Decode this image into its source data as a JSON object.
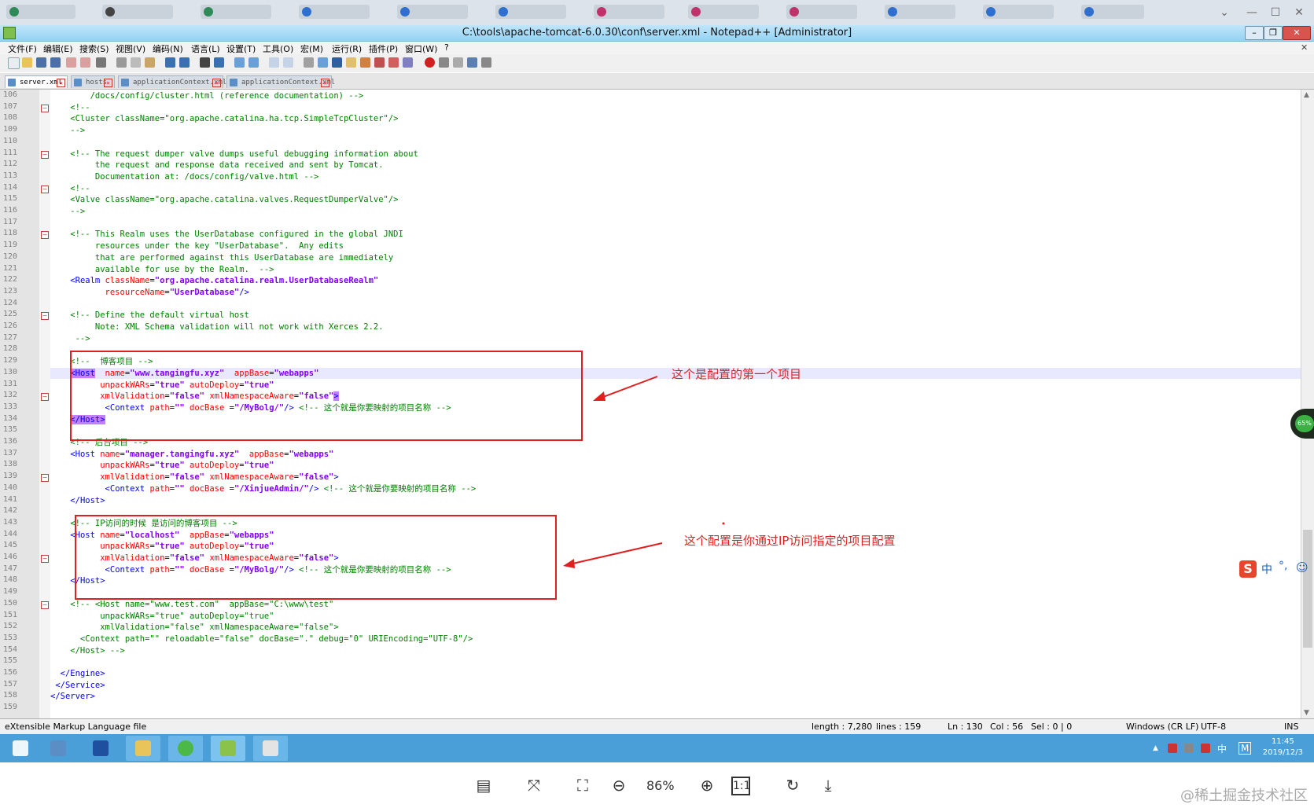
{
  "window": {
    "title": "C:\\tools\\apache-tomcat-6.0.30\\conf\\server.xml - Notepad++ [Administrator]"
  },
  "menu": [
    "文件(F)",
    "编辑(E)",
    "搜索(S)",
    "视图(V)",
    "编码(N)",
    "语言(L)",
    "设置(T)",
    "工具(O)",
    "宏(M)",
    "运行(R)",
    "插件(P)",
    "窗口(W)",
    "?"
  ],
  "tabs": [
    "server.xml",
    "hosts",
    "applicationContext.xml",
    "applicationContext.xml"
  ],
  "code_lines": [
    {
      "n": "106",
      "segs": [
        {
          "t": "        /docs/config/cluster.html (reference documentation) -->",
          "c": "cm"
        }
      ]
    },
    {
      "n": "107",
      "segs": [
        {
          "t": "    <!--",
          "c": "cm"
        }
      ]
    },
    {
      "n": "108",
      "segs": [
        {
          "t": "    <Cluster className=\"org.apache.catalina.ha.tcp.SimpleTcpCluster\"/>",
          "c": "cm"
        }
      ]
    },
    {
      "n": "109",
      "segs": [
        {
          "t": "    -->",
          "c": "cm"
        }
      ]
    },
    {
      "n": "110",
      "segs": []
    },
    {
      "n": "111",
      "segs": [
        {
          "t": "    <!-- The request dumper valve dumps useful debugging information about",
          "c": "cm"
        }
      ]
    },
    {
      "n": "112",
      "segs": [
        {
          "t": "         the request and response data received and sent by Tomcat.",
          "c": "cm"
        }
      ]
    },
    {
      "n": "113",
      "segs": [
        {
          "t": "         Documentation at: /docs/config/valve.html -->",
          "c": "cm"
        }
      ]
    },
    {
      "n": "114",
      "segs": [
        {
          "t": "    <!--",
          "c": "cm"
        }
      ]
    },
    {
      "n": "115",
      "segs": [
        {
          "t": "    <Valve className=\"org.apache.catalina.valves.RequestDumperValve\"/>",
          "c": "cm"
        }
      ]
    },
    {
      "n": "116",
      "segs": [
        {
          "t": "    -->",
          "c": "cm"
        }
      ]
    },
    {
      "n": "117",
      "segs": []
    },
    {
      "n": "118",
      "segs": [
        {
          "t": "    <!-- This Realm uses the UserDatabase configured in the global JNDI",
          "c": "cm"
        }
      ]
    },
    {
      "n": "119",
      "segs": [
        {
          "t": "         resources under the key \"UserDatabase\".  Any edits",
          "c": "cm"
        }
      ]
    },
    {
      "n": "120",
      "segs": [
        {
          "t": "         that are performed against this UserDatabase are immediately",
          "c": "cm"
        }
      ]
    },
    {
      "n": "121",
      "segs": [
        {
          "t": "         available for use by the Realm.  -->",
          "c": "cm"
        }
      ]
    },
    {
      "n": "122",
      "segs": [
        {
          "t": "    ",
          "c": "txt"
        },
        {
          "t": "<Realm",
          "c": "tag"
        },
        {
          "t": " className",
          "c": "attr"
        },
        {
          "t": "=",
          "c": "txt"
        },
        {
          "t": "\"org.apache.catalina.realm.UserDatabaseRealm\"",
          "c": "val"
        }
      ]
    },
    {
      "n": "123",
      "segs": [
        {
          "t": "           resourceName",
          "c": "attr"
        },
        {
          "t": "=",
          "c": "txt"
        },
        {
          "t": "\"UserDatabase\"",
          "c": "val"
        },
        {
          "t": "/>",
          "c": "tag"
        }
      ]
    },
    {
      "n": "124",
      "segs": []
    },
    {
      "n": "125",
      "segs": [
        {
          "t": "    <!-- Define the default virtual host",
          "c": "cm"
        }
      ]
    },
    {
      "n": "126",
      "segs": [
        {
          "t": "         Note: XML Schema validation will not work with Xerces 2.2.",
          "c": "cm"
        }
      ]
    },
    {
      "n": "127",
      "segs": [
        {
          "t": "     -->",
          "c": "cm"
        }
      ]
    },
    {
      "n": "128",
      "segs": []
    },
    {
      "n": "129",
      "segs": [
        {
          "t": "    <!--  博客项目 -->",
          "c": "cm"
        }
      ]
    },
    {
      "n": "130",
      "segs": [
        {
          "t": "    ",
          "c": "txt"
        },
        {
          "t": "<Host",
          "c": "tag",
          "hl": true
        },
        {
          "t": "  name",
          "c": "attr"
        },
        {
          "t": "=",
          "c": "txt"
        },
        {
          "t": "\"www.tangingfu.xyz\"",
          "c": "val"
        },
        {
          "t": "  appBase",
          "c": "attr"
        },
        {
          "t": "=",
          "c": "txt"
        },
        {
          "t": "\"webapps\"",
          "c": "val"
        }
      ]
    },
    {
      "n": "131",
      "segs": [
        {
          "t": "          unpackWARs",
          "c": "attr"
        },
        {
          "t": "=",
          "c": "txt"
        },
        {
          "t": "\"true\"",
          "c": "val"
        },
        {
          "t": " autoDeploy",
          "c": "attr"
        },
        {
          "t": "=",
          "c": "txt"
        },
        {
          "t": "\"true\"",
          "c": "val"
        }
      ]
    },
    {
      "n": "132",
      "segs": [
        {
          "t": "          xmlValidation",
          "c": "attr"
        },
        {
          "t": "=",
          "c": "txt"
        },
        {
          "t": "\"false\"",
          "c": "val"
        },
        {
          "t": " xmlNamespaceAware",
          "c": "attr"
        },
        {
          "t": "=",
          "c": "txt"
        },
        {
          "t": "\"false\"",
          "c": "val"
        },
        {
          "t": ">",
          "c": "tag",
          "hl": true
        }
      ]
    },
    {
      "n": "133",
      "segs": [
        {
          "t": "           ",
          "c": "txt"
        },
        {
          "t": "<Context",
          "c": "tag"
        },
        {
          "t": " path",
          "c": "attr"
        },
        {
          "t": "=",
          "c": "txt"
        },
        {
          "t": "\"\"",
          "c": "val"
        },
        {
          "t": " docBase ",
          "c": "attr"
        },
        {
          "t": "=",
          "c": "txt"
        },
        {
          "t": "\"/MyBolg/\"",
          "c": "val"
        },
        {
          "t": "/>",
          "c": "tag"
        },
        {
          "t": " <!-- 这个就是你要映射的项目名称 -->",
          "c": "cm"
        }
      ]
    },
    {
      "n": "134",
      "segs": [
        {
          "t": "    ",
          "c": "txt"
        },
        {
          "t": "</Host>",
          "c": "tag",
          "hl": true
        }
      ]
    },
    {
      "n": "135",
      "segs": []
    },
    {
      "n": "136",
      "segs": [
        {
          "t": "    <!-- 后台项目 -->",
          "c": "cm"
        }
      ]
    },
    {
      "n": "137",
      "segs": [
        {
          "t": "    ",
          "c": "txt"
        },
        {
          "t": "<Host",
          "c": "tag"
        },
        {
          "t": " name",
          "c": "attr"
        },
        {
          "t": "=",
          "c": "txt"
        },
        {
          "t": "\"manager.tangingfu.xyz\"",
          "c": "val"
        },
        {
          "t": "  appBase",
          "c": "attr"
        },
        {
          "t": "=",
          "c": "txt"
        },
        {
          "t": "\"webapps\"",
          "c": "val"
        }
      ]
    },
    {
      "n": "138",
      "segs": [
        {
          "t": "          unpackWARs",
          "c": "attr"
        },
        {
          "t": "=",
          "c": "txt"
        },
        {
          "t": "\"true\"",
          "c": "val"
        },
        {
          "t": " autoDeploy",
          "c": "attr"
        },
        {
          "t": "=",
          "c": "txt"
        },
        {
          "t": "\"true\"",
          "c": "val"
        }
      ]
    },
    {
      "n": "139",
      "segs": [
        {
          "t": "          xmlValidation",
          "c": "attr"
        },
        {
          "t": "=",
          "c": "txt"
        },
        {
          "t": "\"false\"",
          "c": "val"
        },
        {
          "t": " xmlNamespaceAware",
          "c": "attr"
        },
        {
          "t": "=",
          "c": "txt"
        },
        {
          "t": "\"false\"",
          "c": "val"
        },
        {
          "t": ">",
          "c": "tag"
        }
      ]
    },
    {
      "n": "140",
      "segs": [
        {
          "t": "           ",
          "c": "txt"
        },
        {
          "t": "<Context",
          "c": "tag"
        },
        {
          "t": " path",
          "c": "attr"
        },
        {
          "t": "=",
          "c": "txt"
        },
        {
          "t": "\"\"",
          "c": "val"
        },
        {
          "t": " docBase ",
          "c": "attr"
        },
        {
          "t": "=",
          "c": "txt"
        },
        {
          "t": "\"/XinjueAdmin/\"",
          "c": "val"
        },
        {
          "t": "/>",
          "c": "tag"
        },
        {
          "t": " <!-- 这个就是你要映射的项目名称 -->",
          "c": "cm"
        }
      ]
    },
    {
      "n": "141",
      "segs": [
        {
          "t": "    ",
          "c": "txt"
        },
        {
          "t": "</Host>",
          "c": "tag"
        }
      ]
    },
    {
      "n": "142",
      "segs": []
    },
    {
      "n": "143",
      "segs": [
        {
          "t": "    <!-- IP访问的时候 是访问的博客项目 -->",
          "c": "cm"
        }
      ]
    },
    {
      "n": "144",
      "segs": [
        {
          "t": "    ",
          "c": "txt"
        },
        {
          "t": "<Host",
          "c": "tag"
        },
        {
          "t": " name",
          "c": "attr"
        },
        {
          "t": "=",
          "c": "txt"
        },
        {
          "t": "\"localhost\"",
          "c": "val"
        },
        {
          "t": "  appBase",
          "c": "attr"
        },
        {
          "t": "=",
          "c": "txt"
        },
        {
          "t": "\"webapps\"",
          "c": "val"
        }
      ]
    },
    {
      "n": "145",
      "segs": [
        {
          "t": "          unpackWARs",
          "c": "attr"
        },
        {
          "t": "=",
          "c": "txt"
        },
        {
          "t": "\"true\"",
          "c": "val"
        },
        {
          "t": " autoDeploy",
          "c": "attr"
        },
        {
          "t": "=",
          "c": "txt"
        },
        {
          "t": "\"true\"",
          "c": "val"
        }
      ]
    },
    {
      "n": "146",
      "segs": [
        {
          "t": "          xmlValidation",
          "c": "attr"
        },
        {
          "t": "=",
          "c": "txt"
        },
        {
          "t": "\"false\"",
          "c": "val"
        },
        {
          "t": " xmlNamespaceAware",
          "c": "attr"
        },
        {
          "t": "=",
          "c": "txt"
        },
        {
          "t": "\"false\"",
          "c": "val"
        },
        {
          "t": ">",
          "c": "tag"
        }
      ]
    },
    {
      "n": "147",
      "segs": [
        {
          "t": "           ",
          "c": "txt"
        },
        {
          "t": "<Context",
          "c": "tag"
        },
        {
          "t": " path",
          "c": "attr"
        },
        {
          "t": "=",
          "c": "txt"
        },
        {
          "t": "\"\"",
          "c": "val"
        },
        {
          "t": " docBase ",
          "c": "attr"
        },
        {
          "t": "=",
          "c": "txt"
        },
        {
          "t": "\"/MyBolg/\"",
          "c": "val"
        },
        {
          "t": "/>",
          "c": "tag"
        },
        {
          "t": " <!-- 这个就是你要映射的项目名称 -->",
          "c": "cm"
        }
      ]
    },
    {
      "n": "148",
      "segs": [
        {
          "t": "    ",
          "c": "txt"
        },
        {
          "t": "</Host>",
          "c": "tag"
        }
      ]
    },
    {
      "n": "149",
      "segs": []
    },
    {
      "n": "150",
      "segs": [
        {
          "t": "    <!-- <Host name=\"www.test.com\"  appBase=\"C:\\www\\test\"",
          "c": "cm"
        }
      ]
    },
    {
      "n": "151",
      "segs": [
        {
          "t": "          unpackWARs=\"true\" autoDeploy=\"true\"",
          "c": "cm"
        }
      ]
    },
    {
      "n": "152",
      "segs": [
        {
          "t": "          xmlValidation=\"false\" xmlNamespaceAware=\"false\">",
          "c": "cm"
        }
      ]
    },
    {
      "n": "153",
      "segs": [
        {
          "t": "      <Context path=\"\" reloadable=\"false\" docBase=\".\" debug=\"0\" URIEncoding=\"UTF-8\"/>",
          "c": "cm"
        }
      ]
    },
    {
      "n": "154",
      "segs": [
        {
          "t": "    </Host> -->",
          "c": "cm"
        }
      ]
    },
    {
      "n": "155",
      "segs": []
    },
    {
      "n": "156",
      "segs": [
        {
          "t": "  ",
          "c": "txt"
        },
        {
          "t": "</Engine>",
          "c": "tag"
        }
      ]
    },
    {
      "n": "157",
      "segs": [
        {
          "t": " ",
          "c": "txt"
        },
        {
          "t": "</Service>",
          "c": "tag"
        }
      ]
    },
    {
      "n": "158",
      "segs": [
        {
          "t": "</Server>",
          "c": "tag"
        }
      ]
    },
    {
      "n": "159",
      "segs": []
    }
  ],
  "fold_lines": [
    "107",
    "111",
    "114",
    "118",
    "125",
    "132",
    "139",
    "146",
    "150"
  ],
  "current_line": "130",
  "annotations": {
    "first": "这个是配置的第一个项目",
    "second": "这个配置是你通过IP访问指定的项目配置"
  },
  "status": {
    "filetype": "eXtensible Markup Language file",
    "length": "length : 7,280",
    "lines": "lines : 159",
    "ln": "Ln : 130",
    "col": "Col : 56",
    "sel": "Sel : 0 | 0",
    "eol": "Windows (CR LF)",
    "encoding": "UTF-8",
    "mode": "INS"
  },
  "taskbar": {
    "time": "11:45",
    "date": "2019/12/3"
  },
  "viewer": {
    "zoom": "86%",
    "watermark": "@稀土掘金技术社区"
  },
  "side_badge": "65%",
  "ime_label": "中"
}
